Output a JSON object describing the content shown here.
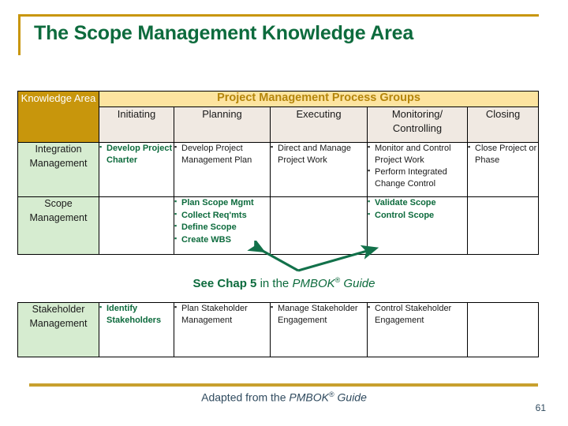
{
  "slide": {
    "title": "The Scope Management Knowledge Area",
    "accent_gold": "#c8960c",
    "accent_green": "#0d6b3d",
    "page_number": "61"
  },
  "table": {
    "corner_label": "Knowledge Area",
    "banner_label": "Project Management Process Groups",
    "process_groups": [
      "Initiating",
      "Planning",
      "Executing",
      "Monitoring/ Controlling",
      "Closing"
    ],
    "rows": [
      {
        "knowledge_area": "Integration Management",
        "cells": [
          {
            "highlight": true,
            "items": [
              "Develop Project Charter"
            ]
          },
          {
            "highlight": false,
            "items": [
              "Develop Project Management Plan"
            ]
          },
          {
            "highlight": false,
            "items": [
              "Direct and Manage Project  Work"
            ]
          },
          {
            "highlight": false,
            "items": [
              "Monitor and Control Project Work",
              "Perform Integrated Change Control"
            ]
          },
          {
            "highlight": false,
            "items": [
              "Close Project or Phase"
            ]
          }
        ]
      },
      {
        "knowledge_area": "Scope Management",
        "cells": [
          {
            "highlight": false,
            "items": []
          },
          {
            "highlight": true,
            "items": [
              "Plan Scope Mgmt",
              "Collect Req'mts",
              "Define Scope",
              "Create WBS"
            ]
          },
          {
            "highlight": false,
            "items": []
          },
          {
            "highlight": true,
            "items": [
              "Validate Scope",
              "Control Scope"
            ]
          },
          {
            "highlight": false,
            "items": []
          }
        ]
      }
    ]
  },
  "stakeholder_table": {
    "rows": [
      {
        "knowledge_area": "Stakeholder Management",
        "cells": [
          {
            "highlight": true,
            "items": [
              "Identify Stakeholders"
            ]
          },
          {
            "highlight": false,
            "items": [
              "Plan Stakeholder Management"
            ]
          },
          {
            "highlight": false,
            "items": [
              "Manage Stakeholder Engagement"
            ]
          },
          {
            "highlight": false,
            "items": [
              "Control Stakeholder Engagement"
            ]
          },
          {
            "highlight": false,
            "items": []
          }
        ]
      }
    ]
  },
  "chapter_note": {
    "bold": "See Chap 5",
    "regular": " in the ",
    "italic_before_sup": "PMBOK",
    "superscript": "®",
    "italic_after_sup": " Guide"
  },
  "footer": {
    "credit_before": "Adapted from the ",
    "credit_italic_before_sup": "PMBOK",
    "credit_superscript": "®",
    "credit_italic_after_sup": " Guide"
  }
}
